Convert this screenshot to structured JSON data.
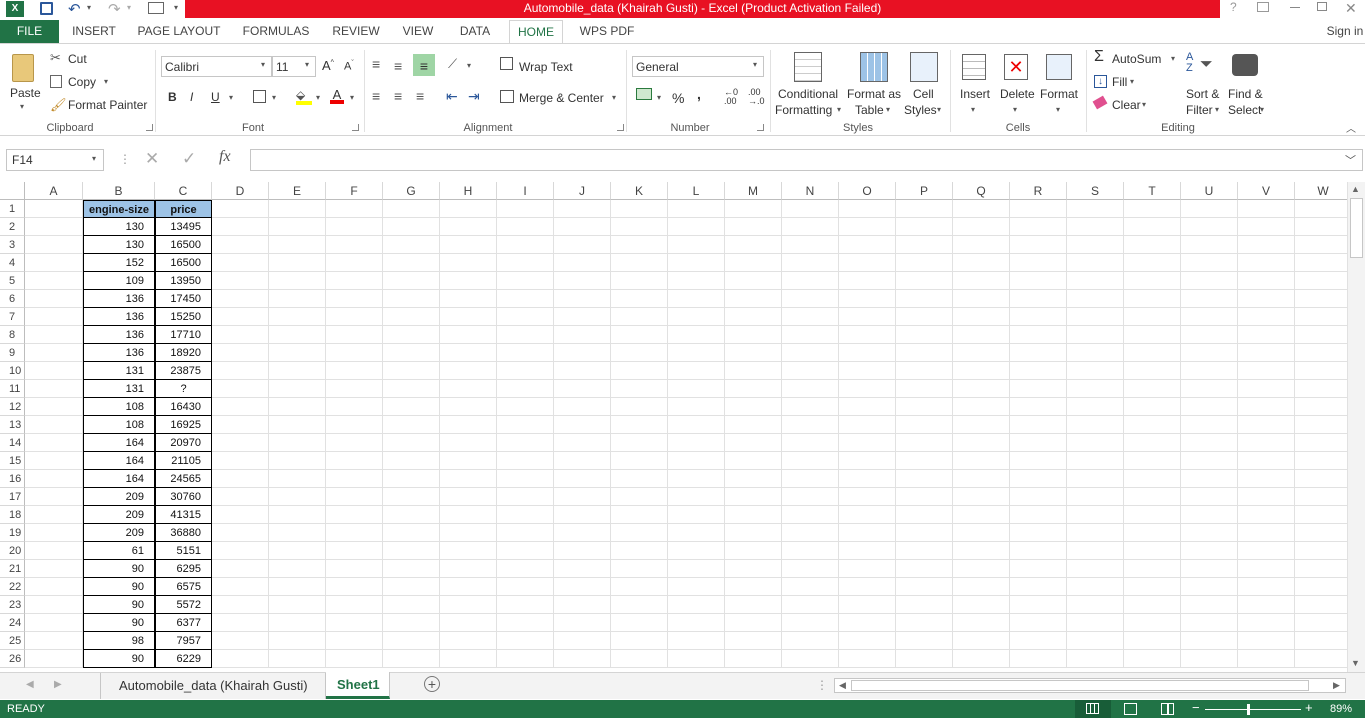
{
  "title": "Automobile_data (Khairah Gusti) -  Excel (Product Activation Failed)",
  "tabs": [
    "FILE",
    "INSERT",
    "PAGE LAYOUT",
    "FORMULAS",
    "REVIEW",
    "VIEW",
    "DATA",
    "HOME",
    "WPS PDF"
  ],
  "sign_in": "Sign in",
  "title_controls": {
    "help": "?"
  },
  "clipboard": {
    "paste": "Paste",
    "cut": "Cut",
    "copy": "Copy",
    "format_painter": "Format Painter",
    "label": "Clipboard"
  },
  "font": {
    "name": "Calibri",
    "size": "11",
    "bold": "B",
    "italic": "I",
    "underline": "U",
    "label": "Font"
  },
  "alignment": {
    "wrap": "Wrap Text",
    "merge": "Merge & Center",
    "label": "Alignment"
  },
  "number": {
    "format": "General",
    "percent": "%",
    "comma": ",",
    "label": "Number"
  },
  "styles": {
    "cond1": "Conditional",
    "cond2": "Formatting",
    "table1": "Format as",
    "table2": "Table",
    "cell1": "Cell",
    "cell2": "Styles",
    "label": "Styles"
  },
  "cells": {
    "insert": "Insert",
    "delete": "Delete",
    "format": "Format",
    "label": "Cells"
  },
  "editing": {
    "autosum": "AutoSum",
    "fill": "Fill",
    "clear": "Clear",
    "sort1": "Sort &",
    "sort2": "Filter",
    "find1": "Find &",
    "find2": "Select",
    "label": "Editing"
  },
  "namebox": "F14",
  "fx": "fx",
  "columns": [
    "A",
    "B",
    "C",
    "D",
    "E",
    "F",
    "G",
    "H",
    "I",
    "J",
    "K",
    "L",
    "M",
    "N",
    "O",
    "P",
    "Q",
    "R",
    "S",
    "T",
    "U",
    "V",
    "W"
  ],
  "rows": [
    "1",
    "2",
    "3",
    "4",
    "5",
    "6",
    "7",
    "8",
    "9",
    "10",
    "11",
    "12",
    "13",
    "14",
    "15",
    "16",
    "17",
    "18",
    "19",
    "20",
    "21",
    "22",
    "23",
    "24",
    "25",
    "26"
  ],
  "headers": {
    "b": "engine-size",
    "c": "price"
  },
  "data": [
    [
      "130",
      "13495"
    ],
    [
      "130",
      "16500"
    ],
    [
      "152",
      "16500"
    ],
    [
      "109",
      "13950"
    ],
    [
      "136",
      "17450"
    ],
    [
      "136",
      "15250"
    ],
    [
      "136",
      "17710"
    ],
    [
      "136",
      "18920"
    ],
    [
      "131",
      "23875"
    ],
    [
      "131",
      "?"
    ],
    [
      "108",
      "16430"
    ],
    [
      "108",
      "16925"
    ],
    [
      "164",
      "20970"
    ],
    [
      "164",
      "21105"
    ],
    [
      "164",
      "24565"
    ],
    [
      "209",
      "30760"
    ],
    [
      "209",
      "41315"
    ],
    [
      "209",
      "36880"
    ],
    [
      "61",
      "5151"
    ],
    [
      "90",
      "6295"
    ],
    [
      "90",
      "6575"
    ],
    [
      "90",
      "5572"
    ],
    [
      "90",
      "6377"
    ],
    [
      "98",
      "7957"
    ],
    [
      "90",
      "6229"
    ]
  ],
  "sheets": [
    "Automobile_data (Khairah Gusti)",
    "Sheet1"
  ],
  "status": {
    "ready": "READY",
    "zoom": "89%"
  },
  "colors": {
    "excel_green": "#217346",
    "title_red": "#e81123",
    "header_fill": "#9dc3e6"
  }
}
